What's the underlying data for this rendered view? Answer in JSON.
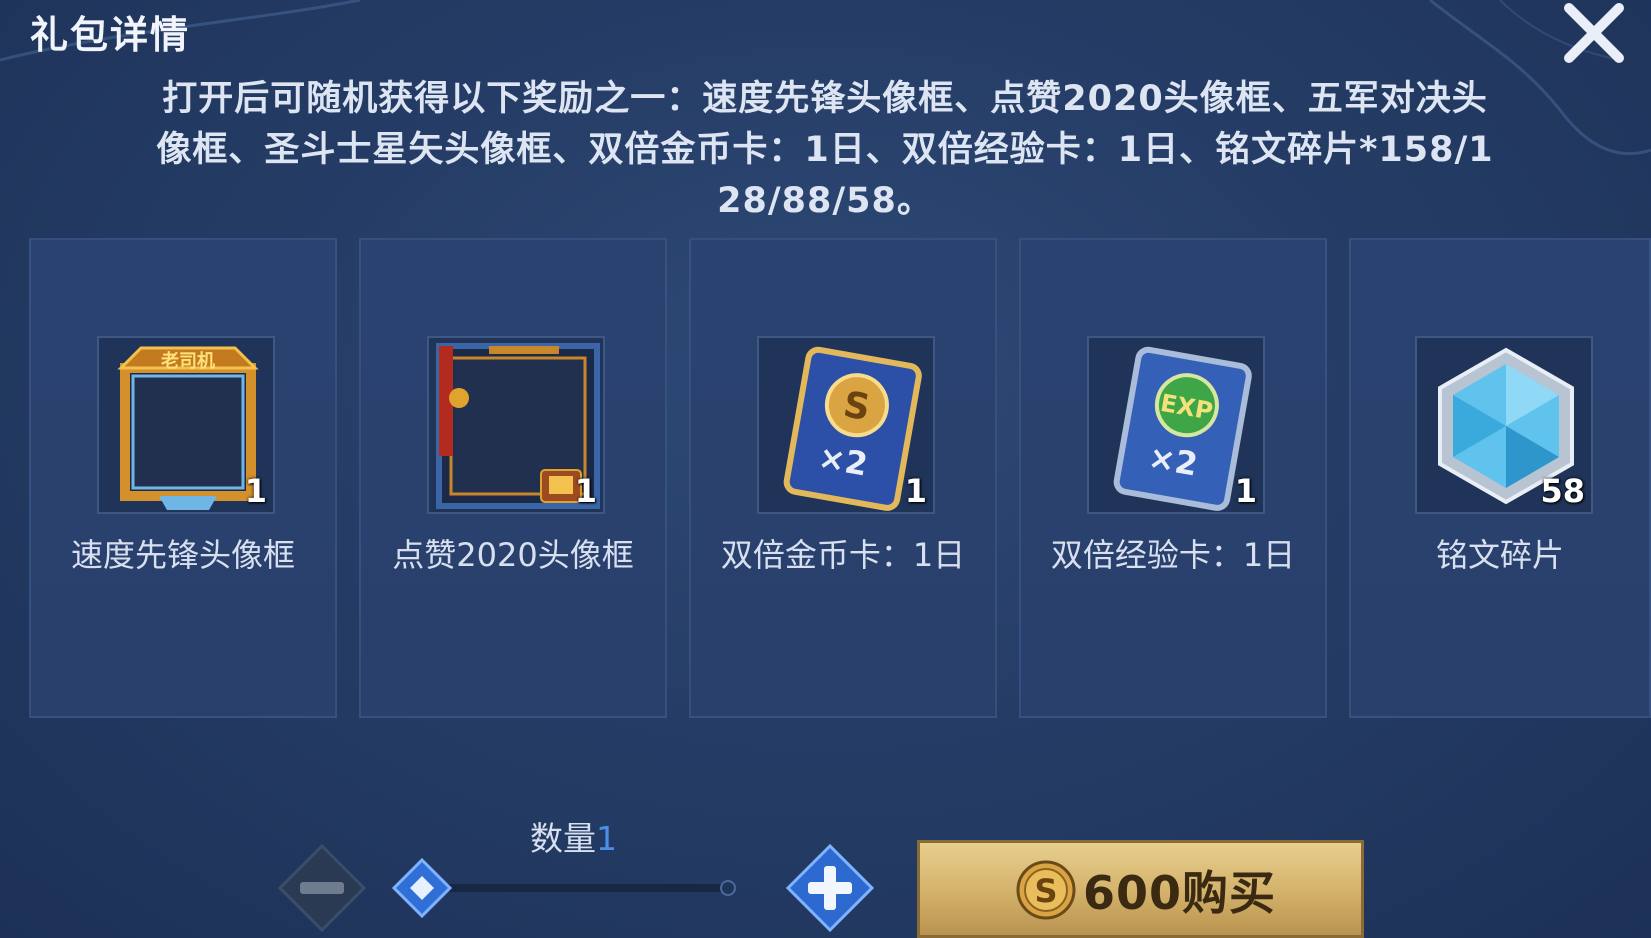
{
  "dialog": {
    "title": "礼包详情",
    "description_lines": [
      "打开后可随机获得以下奖励之一：速度先锋头像框、点赞2020头像框、五军对决头",
      "像框、圣斗士星矢头像框、双倍金币卡：1日、双倍经验卡：1日、铭文碎片*158/1",
      "28/88/58。"
    ]
  },
  "rewards": [
    {
      "name": "速度先锋头像框",
      "count": "1",
      "frame_badge": "老司机",
      "icon": "avatar-frame-icon"
    },
    {
      "name": "点赞2020头像框",
      "count": "1",
      "icon": "avatar-frame-icon"
    },
    {
      "name": "双倍金币卡：1日",
      "count": "1",
      "card_label": "×2",
      "icon": "gold-coin-card-icon"
    },
    {
      "name": "双倍经验卡：1日",
      "count": "1",
      "card_label": "×2",
      "card_badge": "EXP",
      "icon": "exp-card-icon"
    },
    {
      "name": "铭文碎片",
      "count": "58",
      "icon": "inscription-fragment-icon"
    }
  ],
  "quantity": {
    "label": "数量",
    "value": "1"
  },
  "buy": {
    "price": "600",
    "action": "购买",
    "label": "600购买",
    "coin_icon": "gold-coin-icon"
  },
  "colors": {
    "accent_blue": "#4c8fe8",
    "buy_gold": "#d3b16a",
    "panel": "#29406c"
  }
}
